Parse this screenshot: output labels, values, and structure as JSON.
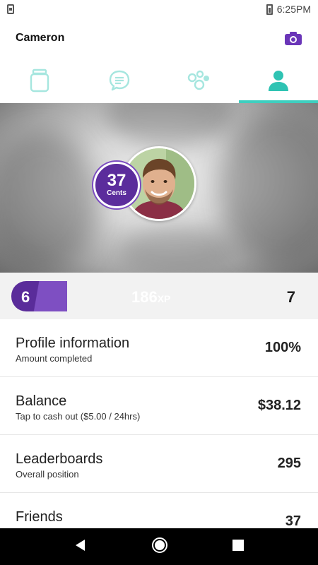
{
  "status_bar": {
    "time": "6:25PM"
  },
  "app_bar": {
    "title": "Cameron",
    "camera_icon": "camera-icon"
  },
  "tabs": [
    {
      "icon": "jar-icon",
      "active": false
    },
    {
      "icon": "chat-icon",
      "active": false
    },
    {
      "icon": "bubbles-icon",
      "active": false
    },
    {
      "icon": "person-icon",
      "active": true
    }
  ],
  "profile": {
    "cents_value": "37",
    "cents_label": "Cents",
    "level": "6",
    "xp_value": "186",
    "xp_unit": "XP",
    "next_level": "7"
  },
  "rows": [
    {
      "title": "Profile information",
      "subtitle": "Amount completed",
      "value": "100%"
    },
    {
      "title": "Balance",
      "subtitle": "Tap to cash out ($5.00 / 24hrs)",
      "value": "$38.12"
    },
    {
      "title": "Leaderboards",
      "subtitle": "Overall position",
      "value": "295"
    },
    {
      "title": "Friends",
      "subtitle": "",
      "value": "37"
    }
  ],
  "colors": {
    "accent_teal": "#3ecfbf",
    "tab_inactive": "#a6e6df",
    "purple": "#5b2d9c",
    "purple_light": "#7e4fc2"
  }
}
